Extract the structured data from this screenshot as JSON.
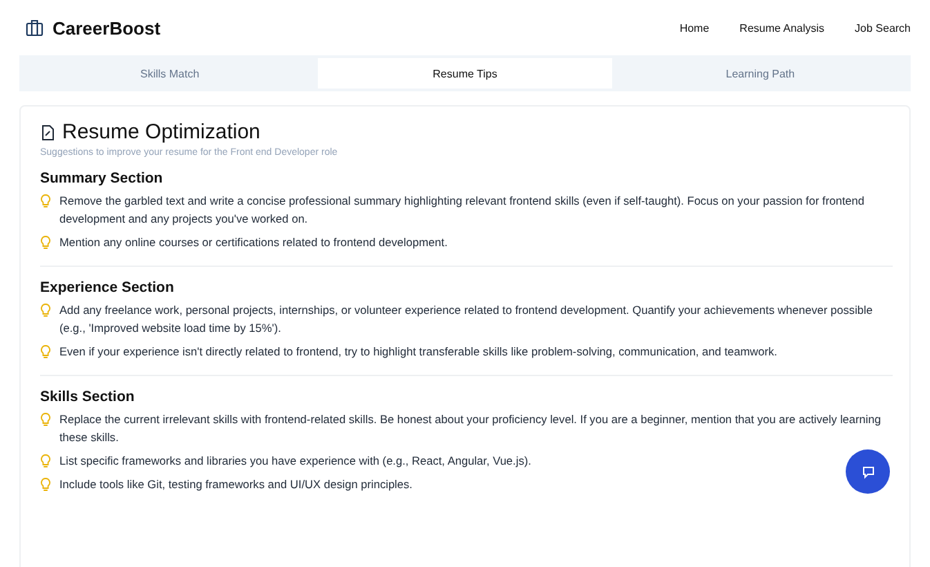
{
  "brand": "CareerBoost",
  "nav": [
    "Home",
    "Resume Analysis",
    "Job Search"
  ],
  "tabs": [
    {
      "label": "Skills Match",
      "selected": false
    },
    {
      "label": "Resume Tips",
      "selected": true
    },
    {
      "label": "Learning Path",
      "selected": false
    }
  ],
  "card": {
    "title": "Resume Optimization",
    "subtitle": "Suggestions to improve your resume for the Front end Developer role",
    "sections": [
      {
        "heading": "Summary Section",
        "tips": [
          "Remove the garbled text and write a concise professional summary highlighting relevant frontend skills (even if self-taught). Focus on your passion for frontend development and any projects you've worked on.",
          "Mention any online courses or certifications related to frontend development."
        ]
      },
      {
        "heading": "Experience Section",
        "tips": [
          "Add any freelance work, personal projects, internships, or volunteer experience related to frontend development. Quantify your achievements whenever possible (e.g., 'Improved website load time by 15%').",
          "Even if your experience isn't directly related to frontend, try to highlight transferable skills like problem-solving, communication, and teamwork."
        ]
      },
      {
        "heading": "Skills Section",
        "tips": [
          "Replace the current irrelevant skills with frontend-related skills. Be honest about your proficiency level. If you are a beginner, mention that you are actively learning these skills.",
          "List specific frameworks and libraries you have experience with (e.g., React, Angular, Vue.js).",
          "Include tools like Git, testing frameworks and UI/UX design principles."
        ]
      }
    ]
  }
}
